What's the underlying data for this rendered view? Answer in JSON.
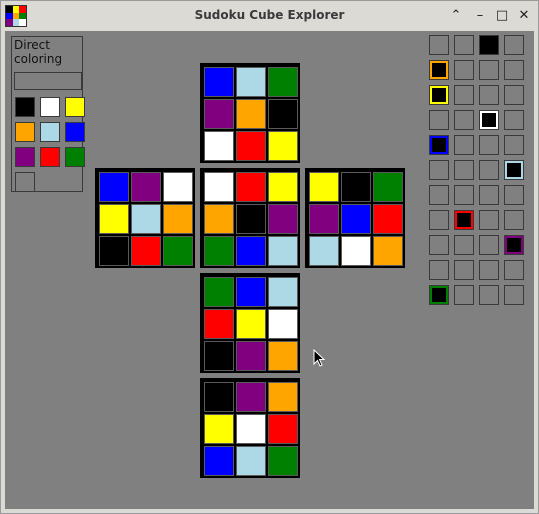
{
  "window": {
    "title": "Sudoku Cube Explorer",
    "controls": {
      "up": "⌃",
      "minimize": "–",
      "maximize": "□",
      "close": "✕"
    }
  },
  "colors": {
    "black": "#000000",
    "white": "#ffffff",
    "yellow": "#ffff00",
    "orange": "#ffa500",
    "lightblue": "#add8e6",
    "blue": "#0000ff",
    "purple": "#800080",
    "red": "#ff0000",
    "green": "#008000",
    "empty": "#808080"
  },
  "palette": {
    "label": "Direct coloring",
    "swatches": [
      "black",
      "white",
      "yellow",
      "orange",
      "lightblue",
      "blue",
      "purple",
      "red",
      "green",
      "empty"
    ]
  },
  "faces": {
    "top": [
      [
        "blue",
        "lightblue",
        "green"
      ],
      [
        "purple",
        "orange",
        "black"
      ],
      [
        "white",
        "red",
        "yellow"
      ]
    ],
    "left": [
      [
        "blue",
        "purple",
        "white"
      ],
      [
        "yellow",
        "lightblue",
        "orange"
      ],
      [
        "black",
        "red",
        "green"
      ]
    ],
    "front": [
      [
        "white",
        "red",
        "yellow"
      ],
      [
        "orange",
        "black",
        "purple"
      ],
      [
        "green",
        "blue",
        "lightblue"
      ]
    ],
    "right": [
      [
        "yellow",
        "black",
        "green"
      ],
      [
        "purple",
        "blue",
        "red"
      ],
      [
        "lightblue",
        "white",
        "orange"
      ]
    ],
    "bottom": [
      [
        "green",
        "blue",
        "lightblue"
      ],
      [
        "red",
        "yellow",
        "white"
      ],
      [
        "black",
        "purple",
        "orange"
      ]
    ],
    "back": [
      [
        "black",
        "purple",
        "orange"
      ],
      [
        "yellow",
        "white",
        "red"
      ],
      [
        "blue",
        "lightblue",
        "green"
      ]
    ]
  },
  "side_grid": [
    [
      "empty",
      "empty",
      "black",
      "empty"
    ],
    [
      "orange",
      "empty",
      "empty",
      "empty"
    ],
    [
      "yellow",
      "empty",
      "empty",
      "empty"
    ],
    [
      "empty",
      "empty",
      "white",
      "empty"
    ],
    [
      "blue",
      "empty",
      "empty",
      "empty"
    ],
    [
      "empty",
      "empty",
      "empty",
      "lightblue"
    ],
    [
      "empty",
      "empty",
      "empty",
      "empty"
    ],
    [
      "empty",
      "red",
      "empty",
      "empty"
    ],
    [
      "empty",
      "empty",
      "empty",
      "purple"
    ],
    [
      "empty",
      "empty",
      "empty",
      "empty"
    ],
    [
      "green",
      "empty",
      "empty",
      "empty"
    ]
  ]
}
